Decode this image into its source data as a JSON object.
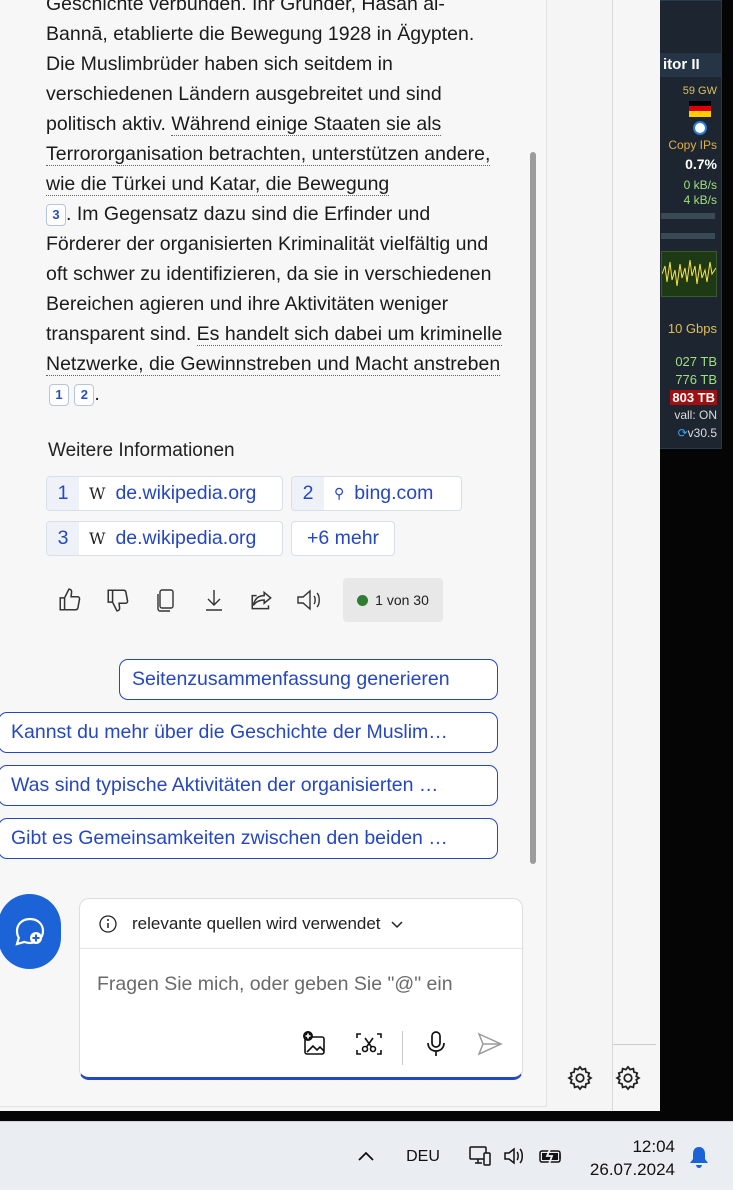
{
  "answer": {
    "s1": "Geschichte verbunden. Ihr Gründer, Hasan al-Bannā, etablierte die Bewegung 1928 in Ägypten. Die Muslimbrüder haben sich seitdem in verschiedenen Ländern ausgebreitet und sind politisch aktiv. ",
    "s2": "Während einige Staaten sie als Terrororganisation betrachten, unterstützen andere, wie die Türkei und Katar, die Bewegung",
    "s3": ". Im Gegensatz dazu sind die Erfinder und Förderer der organisierten Kriminalität vielfältig und oft schwer zu identifizieren, da sie in verschiedenen Bereichen agieren und ihre Aktivitäten weniger transparent sind. ",
    "s4": "Es handelt sich dabei um kriminelle Netzwerke, die Gewinnstreben und Macht anstreben",
    "s5": ".",
    "cite_a": "3",
    "cite_b": "1",
    "cite_c": "2"
  },
  "more_info": {
    "title": "Weitere Informationen",
    "sources": [
      {
        "num": "1",
        "icon": "W",
        "domain": "de.wikipedia.org"
      },
      {
        "num": "2",
        "icon": "⚲",
        "domain": "bing.com"
      },
      {
        "num": "3",
        "icon": "W",
        "domain": "de.wikipedia.org"
      }
    ],
    "more": "+6 mehr"
  },
  "actions": {
    "counter": "1 von 30",
    "counter_color": "#2e7d32"
  },
  "suggestions": [
    "Seitenzusammenfassung generieren",
    "Kannst du mehr über die Geschichte der Muslim…",
    "Was sind typische Aktivitäten der organisierten …",
    "Gibt es Gemeinsamkeiten zwischen den beiden …"
  ],
  "input": {
    "mode": "relevante quellen wird verwendet",
    "placeholder": "Fragen Sie mich, oder geben Sie \"@\" ein"
  },
  "monitor": {
    "title": "itor II",
    "r1": "59   GW",
    "r2": "Copy IPs",
    "r3": "0.7%",
    "r4": "0 kB/s",
    "r5": "4 kB/s",
    "r6": "10 Gbps",
    "r7": "027 TB",
    "r8": "776 TB",
    "r9": "803 TB",
    "r10": "vall: ON",
    "r11": "v30.5"
  },
  "taskbar": {
    "lang": "DEU",
    "time": "12:04",
    "date": "26.07.2024"
  },
  "colors": {
    "accent": "#2547c0",
    "fab": "#1d63d8"
  }
}
